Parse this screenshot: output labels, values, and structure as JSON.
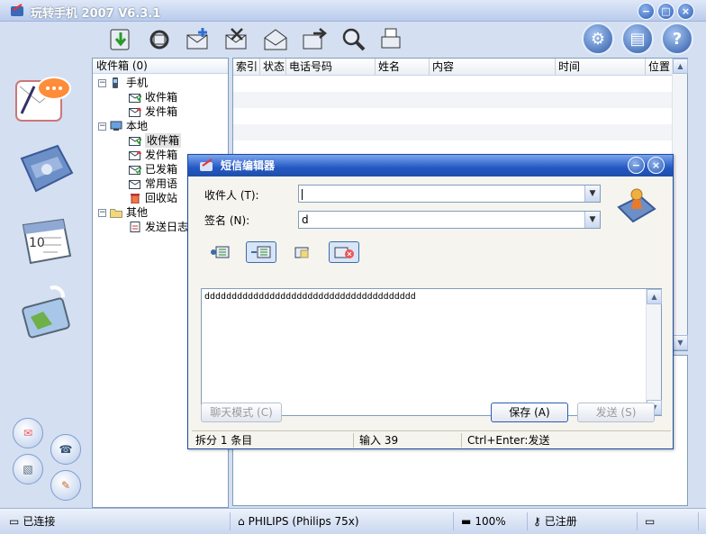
{
  "app": {
    "title": "玩转手机 2007 V6.3.1"
  },
  "window_controls": {
    "minimize": "−",
    "maximize": "□",
    "close": "×"
  },
  "toolbar": {
    "icons": [
      "refresh-down-icon",
      "sync-icon",
      "new-message-icon",
      "delete-message-icon",
      "open-message-icon",
      "forward-message-icon",
      "search-icon",
      "print-icon"
    ],
    "right_icons": [
      "settings-icon",
      "notes-icon",
      "help-icon"
    ]
  },
  "tree": {
    "header": "收件箱 (0)",
    "nodes": [
      {
        "label": "手机",
        "expander": "−",
        "level": 0
      },
      {
        "label": "收件箱",
        "level": 1
      },
      {
        "label": "发件箱",
        "level": 1
      },
      {
        "label": "本地",
        "expander": "−",
        "level": 0
      },
      {
        "label": "收件箱",
        "level": 1,
        "selected": true
      },
      {
        "label": "发件箱",
        "level": 1
      },
      {
        "label": "已发箱",
        "level": 1
      },
      {
        "label": "常用语",
        "level": 1
      },
      {
        "label": "回收站",
        "level": 1
      },
      {
        "label": "其他",
        "expander": "−",
        "level": 0
      },
      {
        "label": "发送日志",
        "level": 1
      }
    ]
  },
  "list": {
    "columns": [
      "索引",
      "状态",
      "电话号码",
      "姓名",
      "内容",
      "时间",
      "位置"
    ]
  },
  "dialog": {
    "title": "短信编辑器",
    "recipient_label": "收件人 (T):",
    "recipient_value": "",
    "signature_label": "签名 (N):",
    "signature_value": "d",
    "message": "ddddddddddddddddddddddddddddddddddddddd",
    "chat_mode_button": "聊天模式 (C)",
    "save_button": "保存 (A)",
    "send_button": "发送 (S)",
    "status": {
      "split": "拆分 1 条目",
      "input": "输入 39",
      "hint": "Ctrl+Enter:发送"
    }
  },
  "statusbar": {
    "connection": "已连接",
    "device": "PHILIPS (Philips 75x)",
    "battery": "100%",
    "registration": "已注册"
  },
  "colors": {
    "accent": "#2358c4",
    "background": "#d4dff2"
  }
}
